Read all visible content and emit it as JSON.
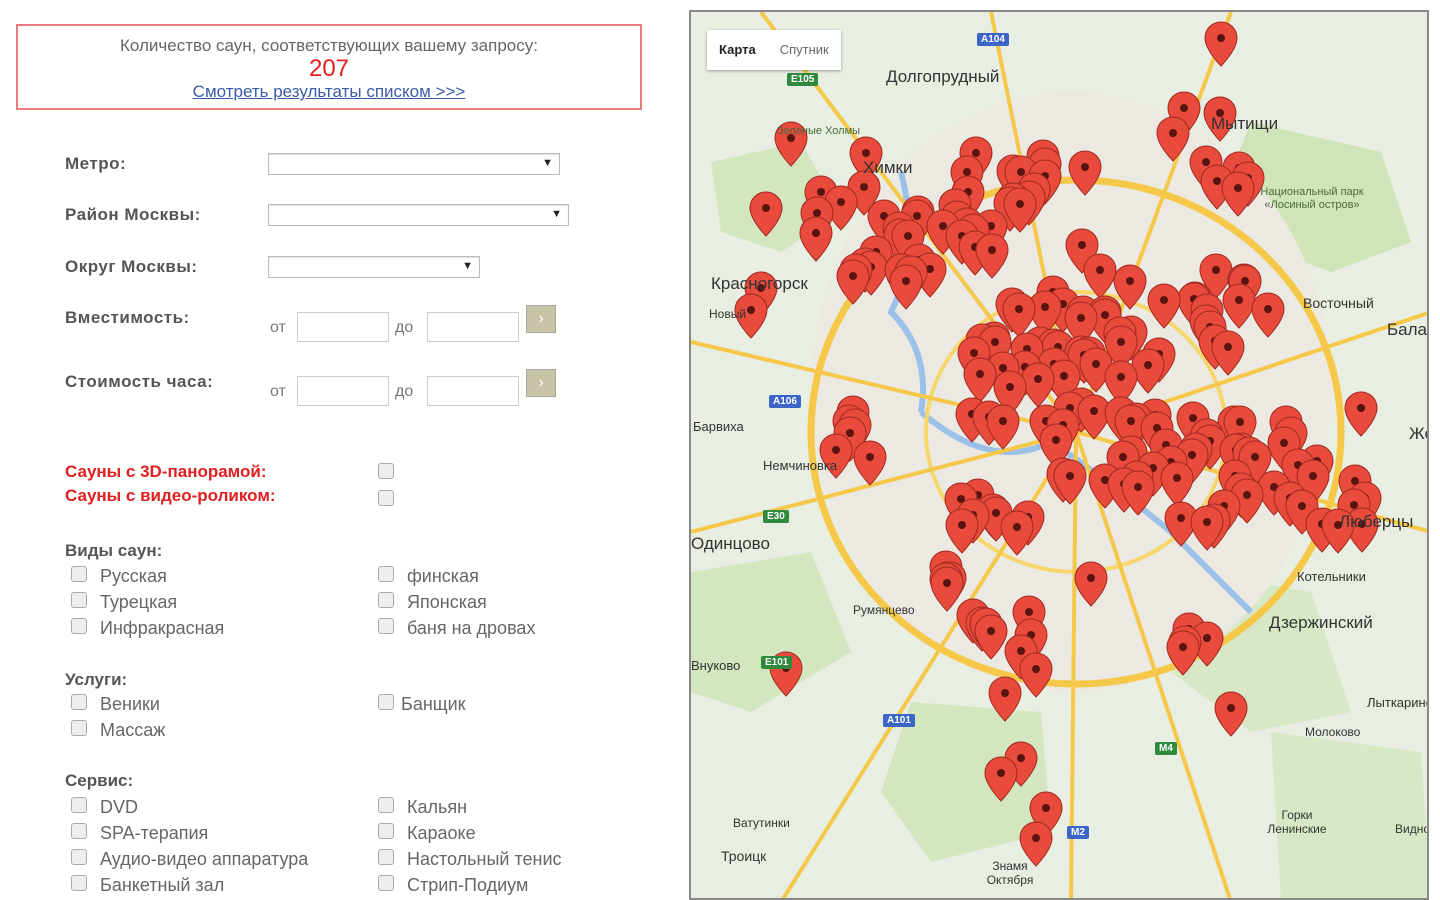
{
  "result": {
    "text": "Количество саун, соответствующих вашему запросу:",
    "count": "207",
    "link": "Смотреть результаты списком >>>"
  },
  "filters": {
    "metro_label": "Метро:",
    "district_label": "Район Москвы:",
    "okrug_label": "Округ Москвы:",
    "capacity_label": "Вместимость:",
    "price_label": "Стоимость часа:",
    "from": "от",
    "to": "до",
    "go": "›"
  },
  "special": {
    "panorama": "Сауны с 3D-панорамой:",
    "video": "Сауны с видео-роликом:"
  },
  "sauna_types": {
    "title": "Виды саун:",
    "items": [
      "Русская",
      "Турецкая",
      "Инфракрасная",
      "финская",
      "Японская",
      "баня на дровах"
    ]
  },
  "services": {
    "title": "Услуги:",
    "items": [
      "Веники",
      "Массаж",
      "Банщик"
    ]
  },
  "facilities": {
    "title": "Сервис:",
    "items": [
      "DVD",
      "SPA-терапия",
      "Аудио-видео аппаратура",
      "Банкетный зал",
      "Кальян",
      "Караоке",
      "Настольный тенис",
      "Стрип-Подиум"
    ]
  },
  "map": {
    "type_map": "Карта",
    "type_satellite": "Спутник",
    "places": [
      "Долгопрудный",
      "Мытищи",
      "Химки",
      "Красногорск",
      "Новый",
      "Барвиха",
      "Немчиновка",
      "Одинцово",
      "Внуково",
      "Румянцево",
      "Восточный",
      "Балашиха",
      "Железнодорожный",
      "Люберцы",
      "Котельники",
      "Дзержинский",
      "Лыткарино",
      "Молоково",
      "Ватутинки",
      "Троицк",
      "Горки Ленинские",
      "Видное",
      "Знамя Октября",
      "Зеленые Холмы",
      "Национальный парк «Лосиный остров»"
    ],
    "roads": [
      "A104",
      "E105",
      "A106",
      "E30",
      "E101",
      "A101",
      "M4",
      "M2"
    ],
    "marker_color": "#e84a3c"
  }
}
